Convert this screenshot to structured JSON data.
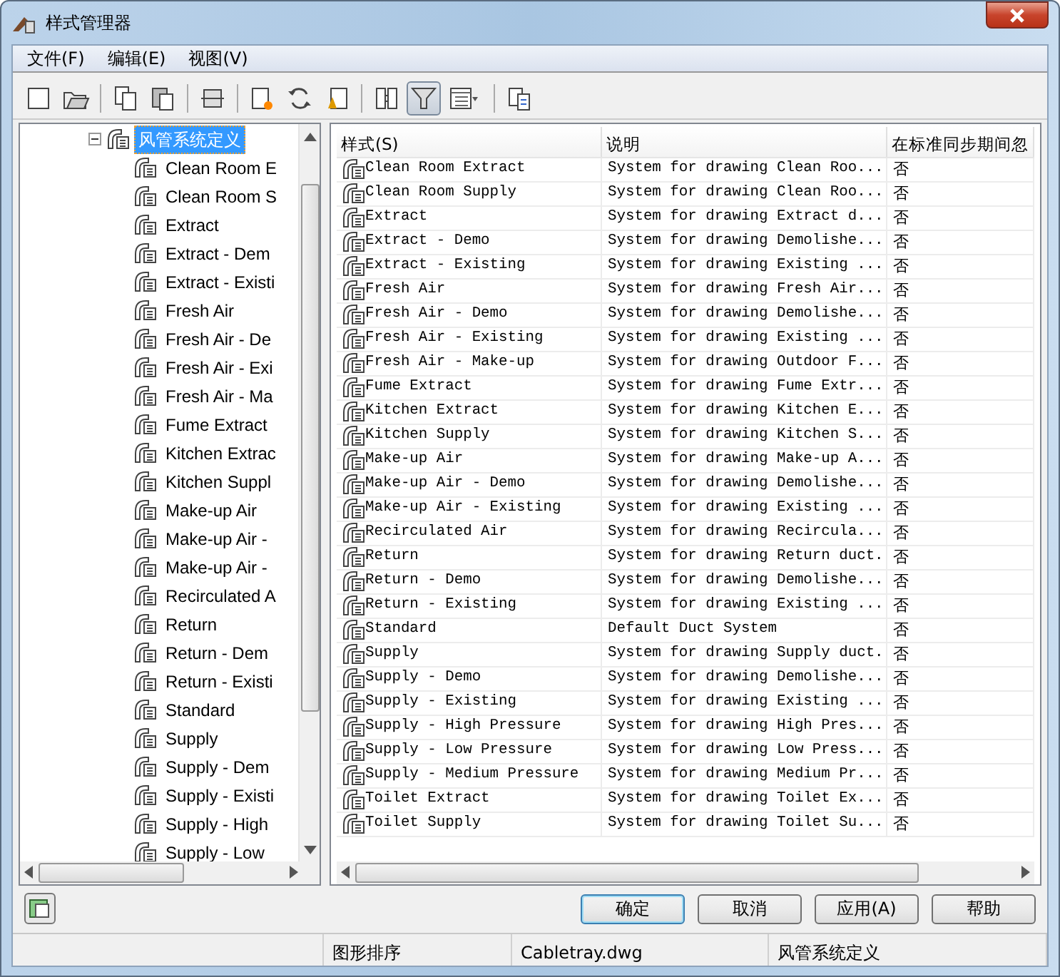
{
  "window": {
    "title": "样式管理器"
  },
  "menu": [
    "文件(F)",
    "编辑(E)",
    "视图(V)"
  ],
  "toolbar": [
    {
      "kind": "new",
      "pressed": false
    },
    {
      "kind": "open",
      "pressed": false
    },
    {
      "kind": "sep"
    },
    {
      "kind": "copy",
      "pressed": false
    },
    {
      "kind": "paste",
      "pressed": false
    },
    {
      "kind": "sep"
    },
    {
      "kind": "edit",
      "pressed": false
    },
    {
      "kind": "sep"
    },
    {
      "kind": "purge",
      "pressed": false
    },
    {
      "kind": "sync",
      "pressed": false
    },
    {
      "kind": "brush",
      "pressed": false
    },
    {
      "kind": "sep"
    },
    {
      "kind": "compare",
      "pressed": false
    },
    {
      "kind": "filter",
      "pressed": true
    },
    {
      "kind": "view",
      "pressed": false
    },
    {
      "kind": "sep"
    },
    {
      "kind": "standards",
      "pressed": false
    }
  ],
  "tree": {
    "label": "风管系统定义",
    "selected": true,
    "expanded": true,
    "children": [
      {
        "label": "Clean Room E"
      },
      {
        "label": "Clean Room S"
      },
      {
        "label": "Extract"
      },
      {
        "label": "Extract - Dem"
      },
      {
        "label": "Extract - Existi"
      },
      {
        "label": "Fresh Air"
      },
      {
        "label": "Fresh Air - De"
      },
      {
        "label": "Fresh Air - Exi"
      },
      {
        "label": "Fresh Air - Ma"
      },
      {
        "label": "Fume Extract"
      },
      {
        "label": "Kitchen Extrac"
      },
      {
        "label": "Kitchen Suppl"
      },
      {
        "label": "Make-up Air"
      },
      {
        "label": "Make-up Air -"
      },
      {
        "label": "Make-up Air -"
      },
      {
        "label": "Recirculated A"
      },
      {
        "label": "Return"
      },
      {
        "label": "Return - Dem"
      },
      {
        "label": "Return - Existi"
      },
      {
        "label": "Standard"
      },
      {
        "label": "Supply"
      },
      {
        "label": "Supply - Dem"
      },
      {
        "label": "Supply - Existi"
      },
      {
        "label": "Supply - High"
      },
      {
        "label": "Supply - Low"
      }
    ]
  },
  "table": {
    "columns": [
      "样式(S)",
      "说明",
      "在标准同步期间忽"
    ],
    "rows": [
      [
        "Clean Room Extract",
        "System for drawing Clean Roo...",
        "否"
      ],
      [
        "Clean Room Supply",
        "System for drawing Clean Roo...",
        "否"
      ],
      [
        "Extract",
        "System for drawing Extract d...",
        "否"
      ],
      [
        "Extract - Demo",
        "System for drawing Demolishe...",
        "否"
      ],
      [
        "Extract - Existing",
        "System for drawing Existing ...",
        "否"
      ],
      [
        "Fresh Air",
        "System for drawing Fresh Air...",
        "否"
      ],
      [
        "Fresh Air - Demo",
        "System for drawing Demolishe...",
        "否"
      ],
      [
        "Fresh Air - Existing",
        "System for drawing Existing ...",
        "否"
      ],
      [
        "Fresh Air - Make-up",
        "System for drawing Outdoor F...",
        "否"
      ],
      [
        "Fume Extract",
        "System for drawing Fume Extr...",
        "否"
      ],
      [
        "Kitchen Extract",
        "System for drawing Kitchen E...",
        "否"
      ],
      [
        "Kitchen Supply",
        "System for drawing Kitchen S...",
        "否"
      ],
      [
        "Make-up Air",
        "System for drawing Make-up A...",
        "否"
      ],
      [
        "Make-up Air - Demo",
        "System for drawing Demolishe...",
        "否"
      ],
      [
        "Make-up Air - Existing",
        "System for drawing Existing ...",
        "否"
      ],
      [
        "Recirculated Air",
        "System for drawing Recircula...",
        "否"
      ],
      [
        "Return",
        "System for drawing Return duct.",
        "否"
      ],
      [
        "Return - Demo",
        "System for drawing Demolishe...",
        "否"
      ],
      [
        "Return - Existing",
        "System for drawing Existing ...",
        "否"
      ],
      [
        "Standard",
        "Default Duct System",
        "否"
      ],
      [
        "Supply",
        "System for drawing Supply duct.",
        "否"
      ],
      [
        "Supply - Demo",
        "System for drawing Demolishe...",
        "否"
      ],
      [
        "Supply - Existing",
        "System for drawing Existing ...",
        "否"
      ],
      [
        "Supply - High Pressure",
        "System for drawing High Pres...",
        "否"
      ],
      [
        "Supply - Low Pressure",
        "System for drawing Low Press...",
        "否"
      ],
      [
        "Supply - Medium Pressure",
        "System for drawing Medium Pr...",
        "否"
      ],
      [
        "Toilet Extract",
        "System for drawing Toilet Ex...",
        "否"
      ],
      [
        "Toilet Supply",
        "System for drawing Toilet Su...",
        "否"
      ]
    ]
  },
  "buttons": [
    {
      "label": "确定",
      "default": true
    },
    {
      "label": "取消",
      "default": false
    },
    {
      "label": "应用(A)",
      "default": false
    },
    {
      "label": "帮助",
      "default": false
    }
  ],
  "status_bar": [
    "图形排序",
    "Cabletray.dwg",
    "风管系统定义"
  ]
}
